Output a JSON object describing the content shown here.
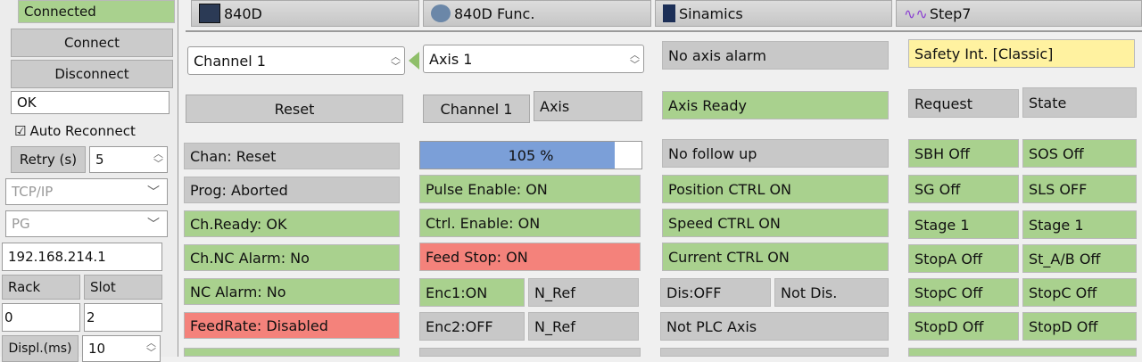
{
  "left": {
    "status": "Connected",
    "connect": "Connect",
    "disconnect": "Disconnect",
    "message": "OK",
    "auto_reconnect": "Auto Reconnect",
    "retry_label": "Retry (s)",
    "retry_value": "5",
    "protocol": "TCP/IP",
    "device": "PG",
    "ip": "192.168.214.1",
    "rack_label": "Rack",
    "slot_label": "Slot",
    "rack_value": "0",
    "slot_value": "2",
    "displ_label": "Displ.(ms)",
    "displ_value": "10",
    "checkbox": "☑"
  },
  "tabs": [
    "840D",
    "840D Func.",
    "Sinamics",
    "Step7"
  ],
  "col1": {
    "channel_select": "Channel 1",
    "reset": "Reset",
    "items": [
      {
        "text": "Chan: Reset",
        "style": "gr"
      },
      {
        "text": "Prog: Aborted",
        "style": "gr"
      },
      {
        "text": "Ch.Ready: OK",
        "style": "g"
      },
      {
        "text": "Ch.NC Alarm: No",
        "style": "g"
      },
      {
        "text": "NC Alarm: No",
        "style": "g"
      },
      {
        "text": "FeedRate: Disabled",
        "style": "r"
      }
    ]
  },
  "col2": {
    "axis_select": "Axis 1",
    "channel_label": "Channel 1",
    "axis_label": "Axis",
    "progress_text": "105 %",
    "progress_fill": 0.88,
    "items": [
      {
        "text": "Pulse Enable: ON",
        "style": "g"
      },
      {
        "text": "Ctrl. Enable: ON",
        "style": "g"
      },
      {
        "text": "Feed Stop: ON",
        "style": "r"
      }
    ],
    "enc1": "Enc1:ON",
    "enc1_ref": "N_Ref",
    "enc2": "Enc2:OFF",
    "enc2_ref": "N_Ref"
  },
  "col3": {
    "items": [
      {
        "text": "No axis alarm",
        "style": "gr"
      },
      {
        "text": "Axis Ready",
        "style": "g"
      },
      {
        "text": "No follow up",
        "style": "gr"
      },
      {
        "text": "Position CTRL ON",
        "style": "g"
      },
      {
        "text": "Speed CTRL ON",
        "style": "g"
      },
      {
        "text": "Current CTRL ON",
        "style": "g"
      }
    ],
    "dis": "Dis:OFF",
    "not_dis": "Not Dis.",
    "not_plc": "Not PLC Axis"
  },
  "col4": {
    "safety": "Safety Int. [Classic]",
    "request_header": "Request",
    "state_header": "State",
    "rows": [
      [
        "SBH Off",
        "SOS Off"
      ],
      [
        "SG Off",
        "SLS OFF"
      ],
      [
        "Stage 1",
        "Stage 1"
      ],
      [
        "StopA Off",
        "St_A/B Off"
      ],
      [
        "StopC Off",
        "StopC Off"
      ],
      [
        "StopD Off",
        "StopD Off"
      ]
    ]
  }
}
